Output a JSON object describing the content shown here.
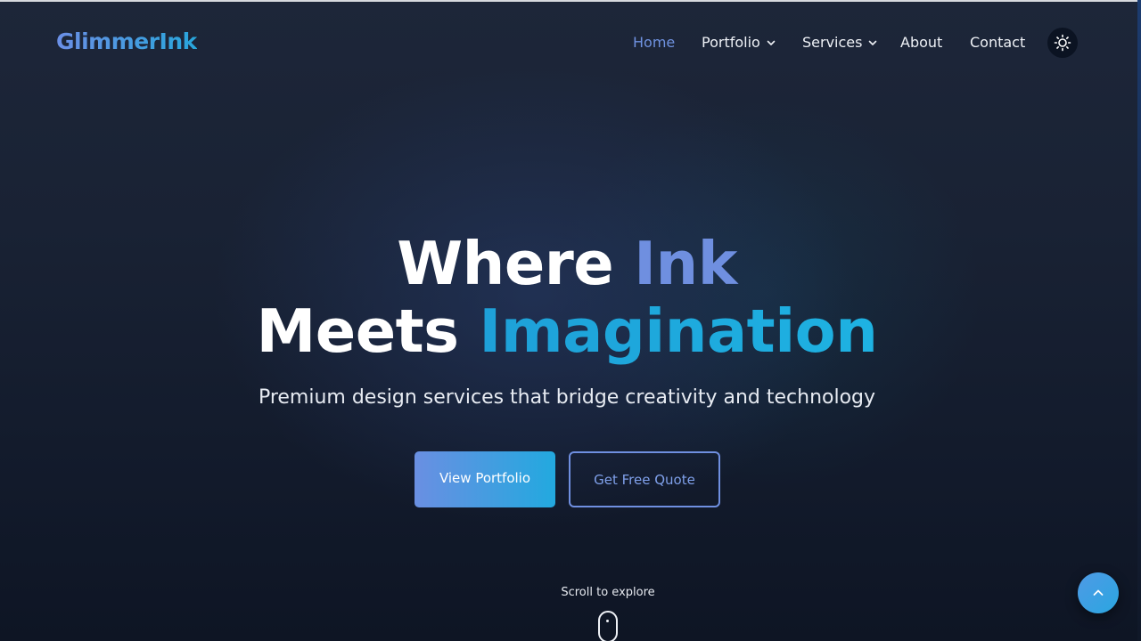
{
  "header": {
    "logo": "GlimmerInk",
    "nav": [
      {
        "label": "Home",
        "active": true
      },
      {
        "label": "Portfolio",
        "dropdown": true
      },
      {
        "label": "Services",
        "dropdown": true
      },
      {
        "label": "About"
      },
      {
        "label": "Contact"
      }
    ],
    "theme_toggle_icon": "sun-icon"
  },
  "hero": {
    "title_line1_a": "Where ",
    "title_line1_b": "Ink",
    "title_line2_a": "Meets ",
    "title_line2_b": "Imagination",
    "subtitle": "Premium design services that bridge creativity and technology",
    "primary_cta": "View Portfolio",
    "secondary_cta": "Get Free Quote"
  },
  "scroll": {
    "label": "Scroll to explore",
    "icon": "mouse-icon"
  },
  "back_to_top_icon": "chevron-up-icon",
  "colors": {
    "accent_blue": "#6f8fe0",
    "accent_cyan": "#1ea0d8",
    "background": "#192234"
  }
}
